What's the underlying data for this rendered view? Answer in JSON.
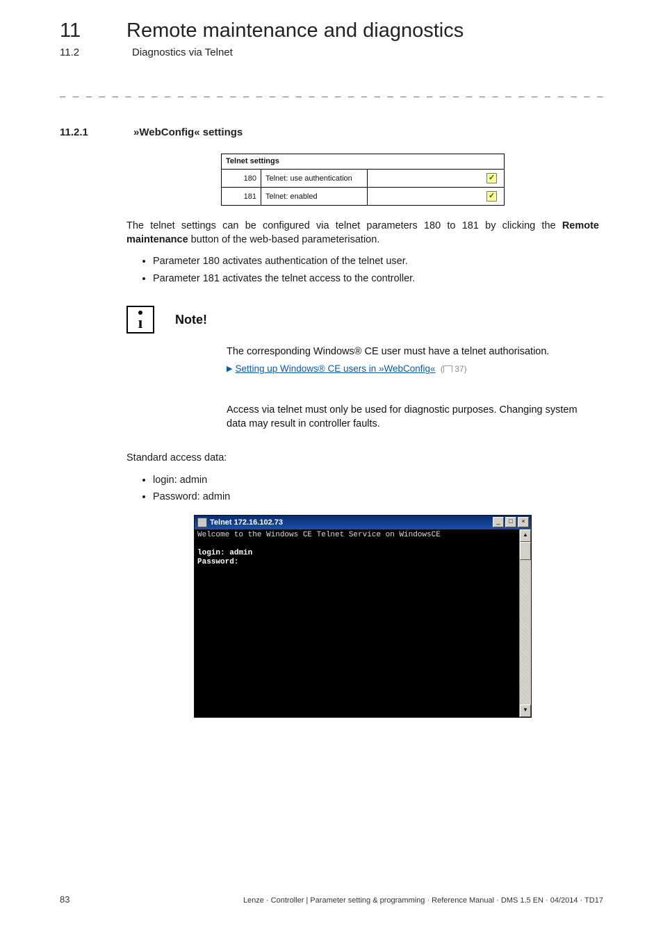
{
  "chapter": {
    "num": "11",
    "title": "Remote maintenance and diagnostics"
  },
  "section": {
    "num": "11.2",
    "title": "Diagnostics via Telnet"
  },
  "dash_rule": "_ _ _ _ _ _ _ _ _ _ _ _ _ _ _ _ _ _ _ _ _ _ _ _ _ _ _ _ _ _ _ _ _ _ _ _ _ _ _ _ _ _ _ _ _ _ _ _ _ _ _ _ _ _ _ _ _ _ _ _ _ _ _ _",
  "h3": {
    "num": "11.2.1",
    "title": "»WebConfig« settings"
  },
  "telnet_settings": {
    "header": "Telnet settings",
    "rows": [
      {
        "id": "180",
        "label": "Telnet: use authentication",
        "checked": true
      },
      {
        "id": "181",
        "label": "Telnet: enabled",
        "checked": true
      }
    ]
  },
  "p1_a": "The telnet settings can be configured via telnet parameters 180 to 181 by clicking the ",
  "p1_b": "Remote maintenance",
  "p1_c": " button of the web-based parameterisation.",
  "bullets1": [
    "Parameter 180 activates authentication of the telnet user.",
    "Parameter 181 activates the telnet access to the controller."
  ],
  "note": {
    "title": "Note!",
    "line1": "The corresponding Windows® CE user must have a telnet authorisation.",
    "link": "Setting up Windows® CE users in »WebConfig«",
    "link_page": "37",
    "warn": "Access via telnet must only be used for diagnostic purposes. Changing system data may result in controller faults."
  },
  "std_access_label": "Standard access data:",
  "std_access": [
    {
      "k": "login:",
      "v": "admin"
    },
    {
      "k": "Password:",
      "v": "admin"
    }
  ],
  "telnet_window": {
    "title": "Telnet 172.16.102.73",
    "welcome": "Welcome to the Windows CE Telnet Service on WindowsCE",
    "login": "login: admin",
    "password": "Password:"
  },
  "footer": {
    "page": "83",
    "text": "Lenze · Controller | Parameter setting & programming · Reference Manual · DMS 1.5 EN · 04/2014 · TD17"
  }
}
